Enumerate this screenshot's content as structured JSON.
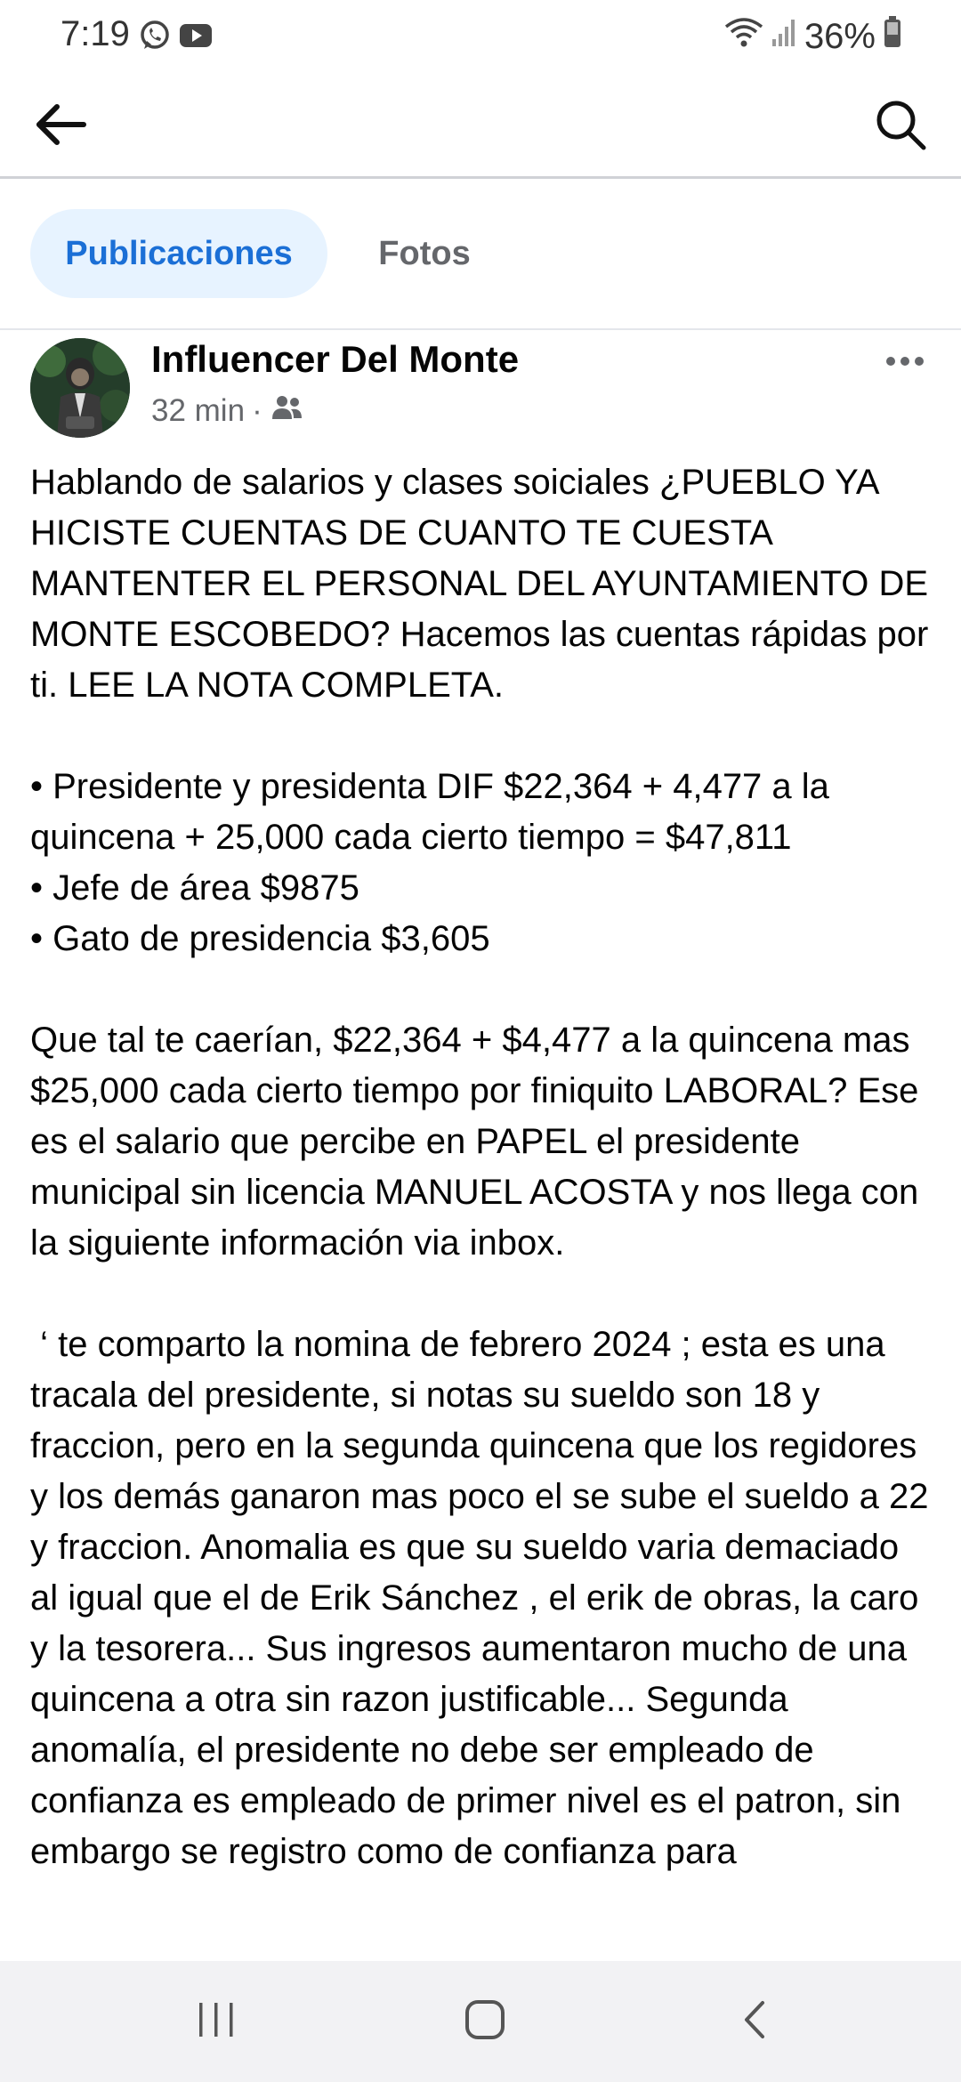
{
  "status_bar": {
    "time": "7:19",
    "battery": "36%",
    "left_icons": [
      "whatsapp-icon",
      "youtube-icon"
    ],
    "right_icons": [
      "wifi-icon",
      "signal-icon",
      "battery-icon"
    ]
  },
  "top_bar": {
    "back_icon": "arrow-left-icon",
    "search_icon": "search-icon"
  },
  "tabs": [
    {
      "label": "Publicaciones",
      "active": true
    },
    {
      "label": "Fotos",
      "active": false
    }
  ],
  "post": {
    "author": "Influencer Del Monte",
    "time": "32 min",
    "separator": "·",
    "audience_icon": "friends-icon",
    "paragraphs": [
      "Hablando de salarios y clases soiciales ¿PUEBLO YA HICISTE CUENTAS DE CUANTO TE CUESTA MANTENTER EL PERSONAL DEL AYUNTAMIENTO DE MONTE ESCOBEDO? Hacemos las cuentas rápidas por ti. LEE LA NOTA COMPLETA.",
      "• Presidente y presidenta DIF $22,364 + 4,477 a la quincena + 25,000 cada cierto tiempo  = $47,811",
      "• Jefe de área $9875",
      "• Gato de presidencia $3,605",
      "Que tal te caerían, $22,364 + $4,477 a la quincena mas $25,000 cada cierto tiempo por finiquito LABORAL? Ese es el salario que percibe en PAPEL el presidente municipal sin licencia MANUEL ACOSTA y nos llega con la siguiente información via inbox.",
      " ‘ te comparto la nomina de febrero 2024 ; esta es una tracala del presidente, si notas su sueldo son 18 y fraccion, pero en la segunda quincena que los regidores y los demás ganaron mas poco el se sube el sueldo a 22 y fraccion. Anomalia es que su sueldo varia demaciado al igual que el de Erik Sánchez , el erik de obras, la caro y la tesorera... Sus ingresos aumentaron mucho de una quincena a otra sin razon justificable... Segunda anomalía, el presidente no debe ser empleado de confianza es empleado de primer nivel es el patron, sin embargo se registro como de confianza para"
    ]
  },
  "nav_bar": {
    "buttons": [
      "recent-apps-icon",
      "home-icon",
      "back-icon"
    ]
  }
}
